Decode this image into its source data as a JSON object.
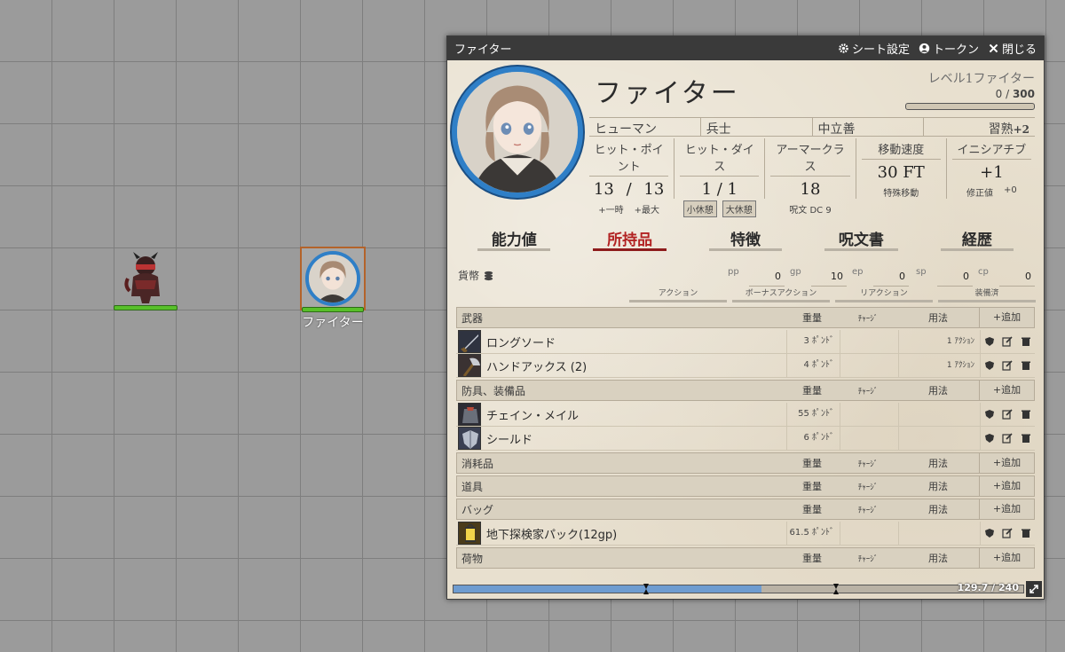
{
  "map": {
    "fighter_token_label": "ファイター",
    "monster_hp": 1.0,
    "fighter_hp": 1.0
  },
  "window": {
    "title": "ファイター",
    "sheet_settings": "シート設定",
    "token": "トークン",
    "close": "閉じる"
  },
  "character": {
    "name": "ファイター",
    "level_class": "レベル1ファイター",
    "xp_current": "0",
    "xp_sep": " / ",
    "xp_next": "300",
    "xp_fraction": 0.0,
    "race": "ヒューマン",
    "background": "兵士",
    "alignment": "中立善",
    "proficiency_label": "習熟",
    "proficiency_value": "+2"
  },
  "stats": {
    "hp": {
      "title": "ヒット・ポイント",
      "current": "13",
      "sep": "/",
      "max": "13",
      "temp_label": "+一時",
      "max_label": "+最大"
    },
    "hit_dice": {
      "title": "ヒット・ダイス",
      "value": "1 / 1",
      "short_rest": "小休憩",
      "long_rest": "大休憩"
    },
    "armor_class": {
      "title": "アーマークラス",
      "value": "18",
      "sub": "呪文 DC 9"
    },
    "speed": {
      "title": "移動速度",
      "value": "30 FT",
      "sub": "特殊移動"
    },
    "initiative": {
      "title": "イニシアチブ",
      "value": "+1",
      "sub_label": "修正値",
      "sub_value": "+0"
    }
  },
  "tabs": [
    {
      "label": "能力値",
      "active": false
    },
    {
      "label": "所持品",
      "active": true
    },
    {
      "label": "特徴",
      "active": false
    },
    {
      "label": "呪文書",
      "active": false
    },
    {
      "label": "経歴",
      "active": false
    }
  ],
  "currency": {
    "label": "貨幣",
    "coins": [
      {
        "code": "pp",
        "value": "0"
      },
      {
        "code": "gp",
        "value": "10"
      },
      {
        "code": "ep",
        "value": "0"
      },
      {
        "code": "sp",
        "value": "0"
      },
      {
        "code": "cp",
        "value": "0"
      }
    ]
  },
  "action_filters": [
    "アクション",
    "ボーナスアクション",
    "リアクション",
    "装備済"
  ],
  "columns": {
    "weight": "重量",
    "charge": "ﾁｬｰｼﾞ",
    "use": "用法",
    "add": "+追加"
  },
  "sections": [
    {
      "name": "武器",
      "items": [
        {
          "name": "ロングソード",
          "weight": "3 ﾎﾟﾝﾄﾞ",
          "use": "1 ｱｸｼｮﾝ",
          "icon": "longsword-icon"
        },
        {
          "name": "ハンドアックス (2)",
          "weight": "4 ﾎﾟﾝﾄﾞ",
          "use": "1 ｱｸｼｮﾝ",
          "icon": "handaxe-icon"
        }
      ]
    },
    {
      "name": "防具、装備品",
      "items": [
        {
          "name": "チェイン・メイル",
          "weight": "55 ﾎﾟﾝﾄﾞ",
          "use": "",
          "icon": "chainmail-icon"
        },
        {
          "name": "シールド",
          "weight": "6 ﾎﾟﾝﾄﾞ",
          "use": "",
          "icon": "shield-item-icon"
        }
      ]
    },
    {
      "name": "消耗品",
      "items": []
    },
    {
      "name": "道具",
      "items": []
    },
    {
      "name": "バッグ",
      "items": [
        {
          "name": "地下探検家パック(12gp)",
          "weight": "61.5 ﾎﾟﾝﾄﾞ",
          "use": "",
          "icon": "lantern-icon"
        }
      ]
    },
    {
      "name": "荷物",
      "items": []
    }
  ],
  "encumbrance": {
    "text": "129.7 / 240",
    "fraction": 0.54
  },
  "colors": {
    "accent": "#2f7fc7",
    "active_tab": "#b22222",
    "hp_bar": "#58c02a",
    "titlebar": "#3a3a3a"
  }
}
